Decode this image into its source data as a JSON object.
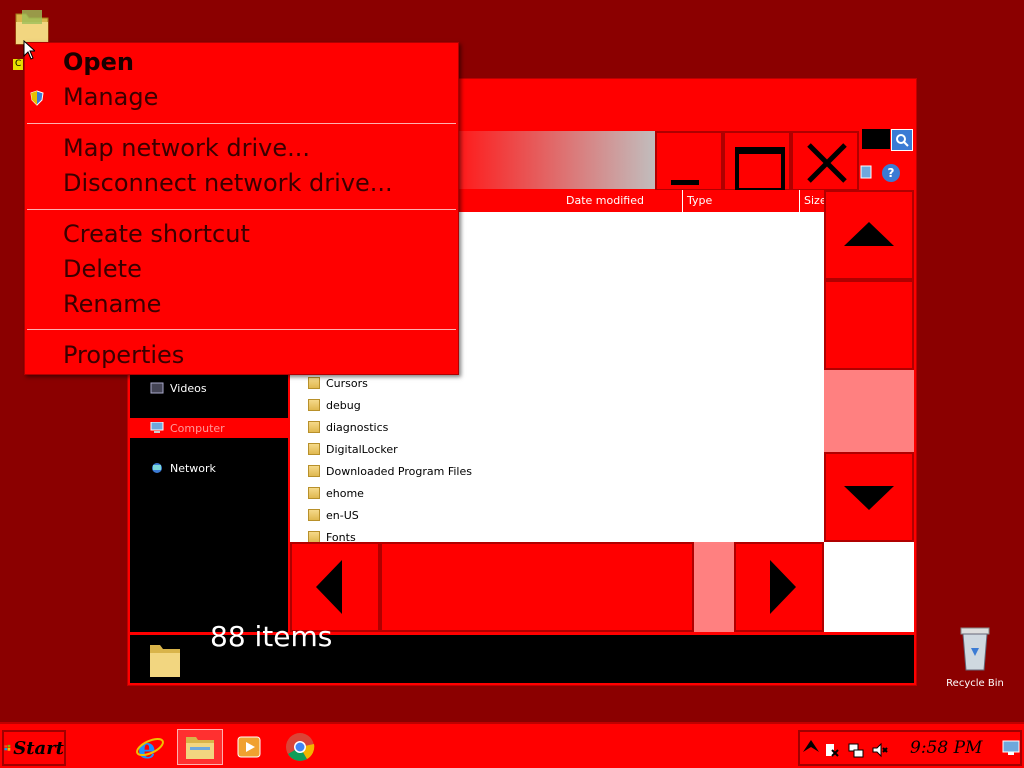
{
  "desktop": {
    "folder_label": "C",
    "recycle_bin_label": "Recycle Bin"
  },
  "explorer": {
    "columns": [
      "Date modified",
      "Type",
      "Size"
    ],
    "nav_items": [
      {
        "label": "Videos",
        "icon": "videos-icon"
      },
      {
        "label": "Computer",
        "icon": "computer-icon",
        "selected": true
      },
      {
        "label": "Network",
        "icon": "network-icon"
      }
    ],
    "files": [
      "Cursors",
      "debug",
      "diagnostics",
      "DigitalLocker",
      "Downloaded Program Files",
      "ehome",
      "en-US",
      "Fonts"
    ],
    "status": "88 items"
  },
  "context_menu": {
    "open": "Open",
    "manage": "Manage",
    "map_drive": "Map network drive...",
    "disconnect_drive": "Disconnect network drive...",
    "create_shortcut": "Create shortcut",
    "delete": "Delete",
    "rename": "Rename",
    "properties": "Properties"
  },
  "taskbar": {
    "start_label": "Start",
    "apps": [
      "internet-explorer-icon",
      "file-explorer-icon",
      "media-player-icon",
      "chrome-icon"
    ],
    "clock": "9:58 PM"
  },
  "colors": {
    "desktop": "#8b0000",
    "accent": "#ff0000",
    "pane": "#000000"
  }
}
